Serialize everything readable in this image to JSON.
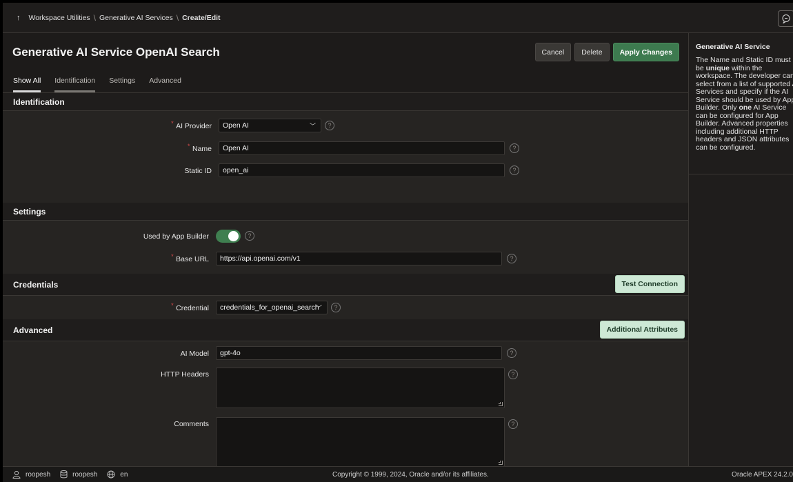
{
  "breadcrumb": {
    "up_icon": "↑",
    "items": [
      "Workspace Utilities",
      "Generative AI Services"
    ],
    "current": "Create/Edit",
    "separator": "\\"
  },
  "chat_icon": "chat-icon",
  "page": {
    "title": "Generative AI Service OpenAI Search",
    "buttons": {
      "cancel": "Cancel",
      "delete": "Delete",
      "apply": "Apply Changes"
    }
  },
  "tabs": [
    "Show All",
    "Identification",
    "Settings",
    "Advanced"
  ],
  "identification": {
    "heading": "Identification",
    "ai_provider": {
      "label": "AI Provider",
      "value": "Open AI"
    },
    "name": {
      "label": "Name",
      "value": "Open AI"
    },
    "static_id": {
      "label": "Static ID",
      "value": "open_ai"
    }
  },
  "settings": {
    "heading": "Settings",
    "used_by_app_builder": {
      "label": "Used by App Builder",
      "on": true
    },
    "base_url": {
      "label": "Base URL",
      "value": "https://api.openai.com/v1"
    }
  },
  "credentials": {
    "heading": "Credentials",
    "test_button": "Test Connection",
    "credential": {
      "label": "Credential",
      "value": "credentials_for_openai_search"
    }
  },
  "advanced": {
    "heading": "Advanced",
    "attributes_button": "Additional Attributes",
    "ai_model": {
      "label": "AI Model",
      "value": "gpt-4o"
    },
    "http_headers": {
      "label": "HTTP Headers",
      "value": ""
    },
    "comments": {
      "label": "Comments",
      "value": ""
    }
  },
  "help_icon_glyph": "?",
  "required_marker": "*",
  "help_panel": {
    "title": "Generative AI Service",
    "p1": "The Name and Static ID must be ",
    "b1": "unique",
    "p2": " within the workspace. The developer can select from a list of supported AI Services and specify if the AI Service should be used by App Builder. Only ",
    "b2": "one",
    "p3": " AI Service can be configured for App Builder. Advanced properties including additional HTTP headers and JSON attributes can be configured."
  },
  "footer": {
    "user": "roopesh",
    "workspace": "roopesh",
    "language": "en",
    "copyright": "Copyright © 1999, 2024, Oracle and/or its affiliates.",
    "version": "Oracle APEX 24.2.0"
  },
  "colors": {
    "accent_green": "#3d7a4f",
    "mint_button": "#cde8d5",
    "required_red": "#d84b4b"
  }
}
